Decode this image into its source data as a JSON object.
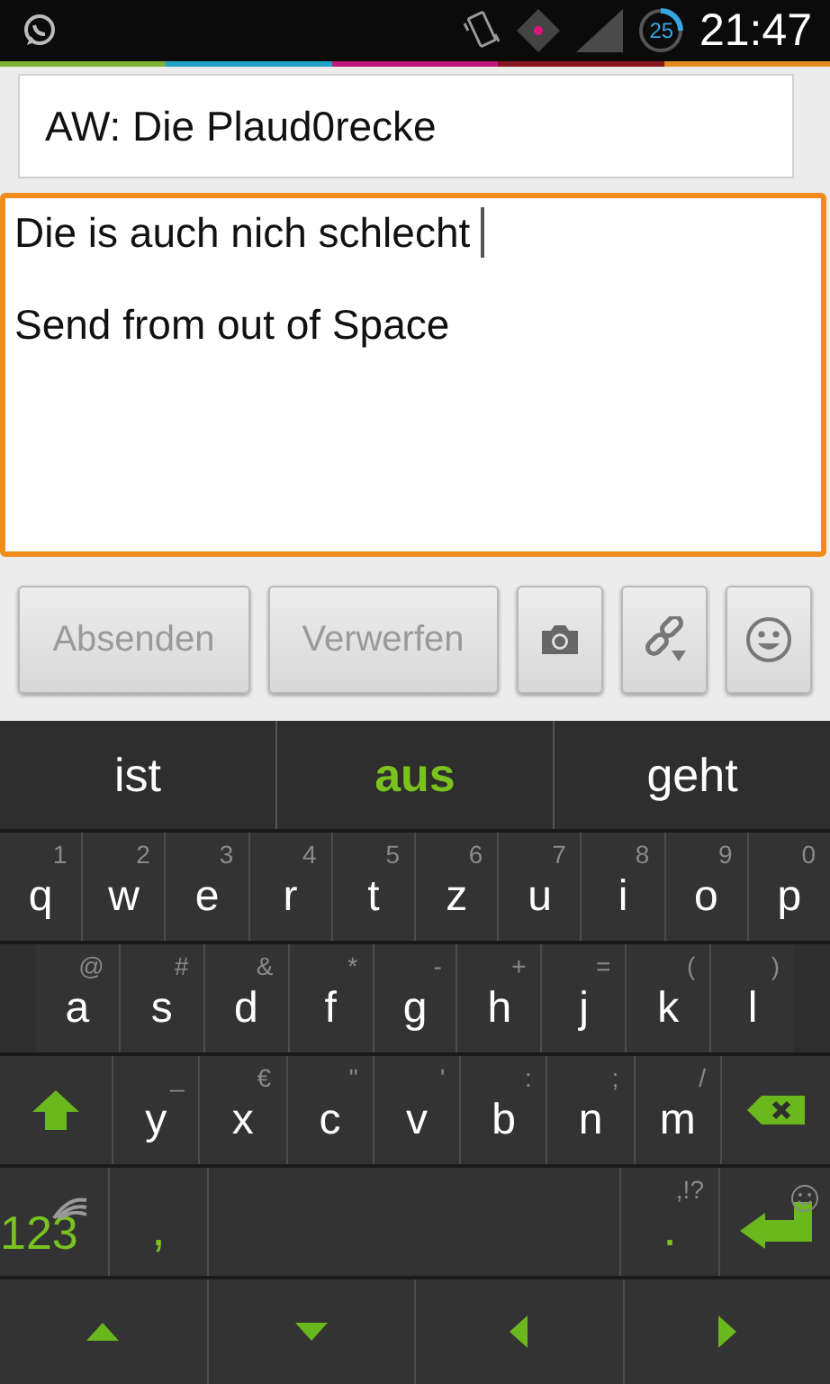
{
  "status_bar": {
    "badge": "25",
    "time": "21:47"
  },
  "subject": {
    "value": "AW: Die Plaud0recke"
  },
  "body": {
    "focused": true,
    "paragraphs": [
      "Die is auch nich schlecht",
      "Send from out of Space"
    ]
  },
  "actions": [
    {
      "kind": "text",
      "label": "Absenden",
      "disabled": true
    },
    {
      "kind": "text",
      "label": "Verwerfen",
      "disabled": true
    },
    {
      "kind": "camera"
    },
    {
      "kind": "link"
    },
    {
      "kind": "smiley"
    }
  ],
  "suggestions": [
    {
      "label": "ist",
      "selected": false
    },
    {
      "label": "aus",
      "selected": true
    },
    {
      "label": "geht",
      "selected": false
    }
  ],
  "keyboard": {
    "rows": [
      {
        "keys": [
          {
            "kind": "char",
            "label": "q",
            "hint": "1"
          },
          {
            "kind": "char",
            "label": "w",
            "hint": "2"
          },
          {
            "kind": "char",
            "label": "e",
            "hint": "3"
          },
          {
            "kind": "char",
            "label": "r",
            "hint": "4"
          },
          {
            "kind": "char",
            "label": "t",
            "hint": "5"
          },
          {
            "kind": "char",
            "label": "z",
            "hint": "6"
          },
          {
            "kind": "char",
            "label": "u",
            "hint": "7"
          },
          {
            "kind": "char",
            "label": "i",
            "hint": "8"
          },
          {
            "kind": "char",
            "label": "o",
            "hint": "9"
          },
          {
            "kind": "char",
            "label": "p",
            "hint": "0"
          }
        ]
      },
      {
        "keys": [
          {
            "kind": "char",
            "label": "a",
            "hint": "@"
          },
          {
            "kind": "char",
            "label": "s",
            "hint": "#"
          },
          {
            "kind": "char",
            "label": "d",
            "hint": "&"
          },
          {
            "kind": "char",
            "label": "f",
            "hint": "*"
          },
          {
            "kind": "char",
            "label": "g",
            "hint": "-"
          },
          {
            "kind": "char",
            "label": "h",
            "hint": "+"
          },
          {
            "kind": "char",
            "label": "j",
            "hint": "="
          },
          {
            "kind": "char",
            "label": "k",
            "hint": "("
          },
          {
            "kind": "char",
            "label": "l",
            "hint": ")"
          }
        ]
      },
      {
        "keys": [
          {
            "kind": "shift"
          },
          {
            "kind": "char",
            "label": "y",
            "hint": "_"
          },
          {
            "kind": "char",
            "label": "x",
            "hint": "€"
          },
          {
            "kind": "char",
            "label": "c",
            "hint": "\""
          },
          {
            "kind": "char",
            "label": "v",
            "hint": "'"
          },
          {
            "kind": "char",
            "label": "b",
            "hint": ":"
          },
          {
            "kind": "char",
            "label": "n",
            "hint": ";"
          },
          {
            "kind": "char",
            "label": "m",
            "hint": "/"
          },
          {
            "kind": "backspace"
          }
        ]
      },
      {
        "keys": [
          {
            "kind": "symbols",
            "label": "123"
          },
          {
            "kind": "punct",
            "label": ","
          },
          {
            "kind": "space"
          },
          {
            "kind": "punct",
            "label": ".",
            "hint": ",!?"
          },
          {
            "kind": "enter"
          }
        ]
      },
      {
        "keys": [
          {
            "kind": "up"
          },
          {
            "kind": "down"
          },
          {
            "kind": "left"
          },
          {
            "kind": "right"
          }
        ]
      }
    ]
  }
}
